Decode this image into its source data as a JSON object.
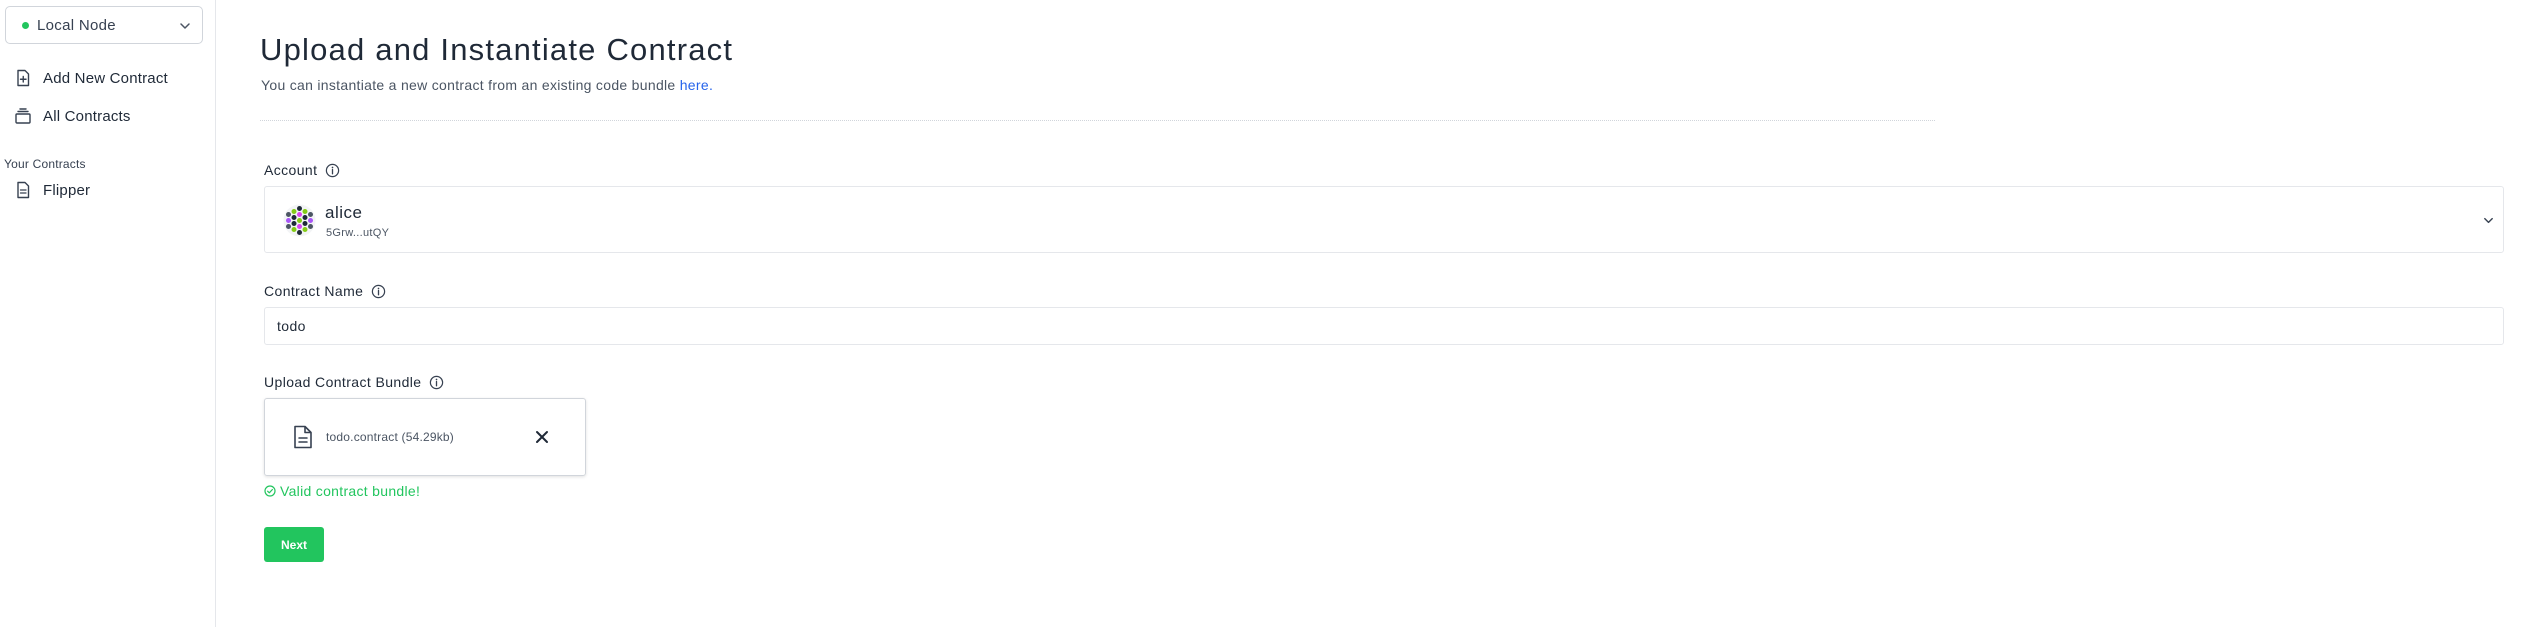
{
  "sidebar": {
    "node_selector": {
      "label": "Local Node",
      "status_color": "#22c55e"
    },
    "nav": [
      {
        "label": "Add New Contract",
        "icon": "file-plus-icon"
      },
      {
        "label": "All Contracts",
        "icon": "stack-icon"
      }
    ],
    "section_title": "Your Contracts",
    "contracts": [
      {
        "label": "Flipper",
        "icon": "document-icon"
      }
    ]
  },
  "main": {
    "title": "Upload and Instantiate Contract",
    "subtitle_text": "You can instantiate a new contract from an existing code bundle ",
    "subtitle_link": "here.",
    "account": {
      "label": "Account",
      "name": "alice",
      "address": "5Grw...utQY",
      "icon": "info-icon"
    },
    "contract_name": {
      "label": "Contract Name",
      "value": "todo",
      "icon": "info-icon"
    },
    "upload": {
      "label": "Upload Contract Bundle",
      "file_name": "todo.contract (54.29kb)",
      "status": "Valid contract bundle!",
      "status_color": "#22c55e"
    },
    "next_label": "Next",
    "accent_color": "#22c55e",
    "link_color": "#2563eb"
  }
}
